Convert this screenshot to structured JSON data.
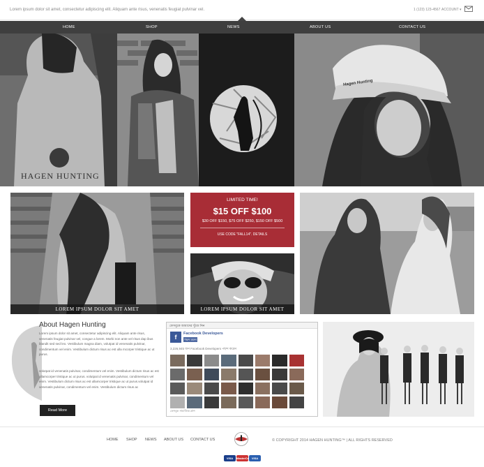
{
  "topbar": {
    "tagline": "Lorem ipsum dolor sit amet, consectetur adipiscing elit. Aliquam ante risus, venenatis feugiat pulvinar vel.",
    "phone": "1 (123) 123-4567",
    "account": "ACCOUNT ▾",
    "cart_count": "0"
  },
  "nav": {
    "items": [
      "HOME",
      "SHOP",
      "NEWS",
      "ABOUT US",
      "CONTACT US"
    ]
  },
  "hero": {
    "brand_text": "HAGEN HUNTING",
    "cap_text": "Hagen Hunting"
  },
  "promo": {
    "line1": "LIMITED TIME!",
    "line2": "$15 OFF $100",
    "line3": "$30 OFF $150, $75 OFF $250, $150 OFF $500",
    "line4": "USE CODE \"FALL14\". DETAILS"
  },
  "captions": {
    "left": "LOREM IPSUM DOLOR SIT AMET",
    "center": "LOREM IPSUM DOLOR SIT AMET"
  },
  "about": {
    "title": "About Hagen Hunting",
    "para1": "Lorem ipsum dolor sit amet, consectetur adipiscing elit. Aliquam ante risus, venenatis feugiat pulvinar vel, congue a lorem. Morbi non ante vel risus dap ibus blandit sed sed leo. Vestibulum magna diam, volutpat id venenatis pulvinar, condimentum vel enim. Vestibulum dictum risus ac est ulla mcorper tristique ac ut purus.",
    "para2": "volutpat id venenatis pulvinar, condimentum vel enim. Vestibulum dictum risus ac est ullamcorper tristique ac ut purus. volutpat id venenatis pulvinar, condimentum vel enim. Vestibulum dictum risus ac est ullamcorper tristique ac ut purus.volutpat id venenatis pulvinar, condimentum vel enim. Vestibulum dictum risus ac",
    "button": "Read More"
  },
  "facebook": {
    "header": "ফেসবুকে আমাদের খুঁজে নিন",
    "page_name": "Facebook Developers",
    "like_label": "পছন্দ করুন",
    "count": "3,226,945 জন Facebook Developers পছন্দ করেন",
    "footer": "ফেসবুক সামাজিক প্লাগ"
  },
  "footer": {
    "links": [
      "HOME",
      "SHOP",
      "NEWS",
      "ABOUT US",
      "CONTACT US"
    ],
    "copyright": "© COPYRIGHT 2014 HAGEN HUNTING™ | ALL RIGHTS RESERVED",
    "payments": [
      "VISA",
      "MasterCard",
      "VISA"
    ]
  },
  "colors": {
    "nav_bg": "#3f3f3f",
    "promo_bg": "#a82d36",
    "button_bg": "#222222",
    "facebook_blue": "#3b5998"
  }
}
